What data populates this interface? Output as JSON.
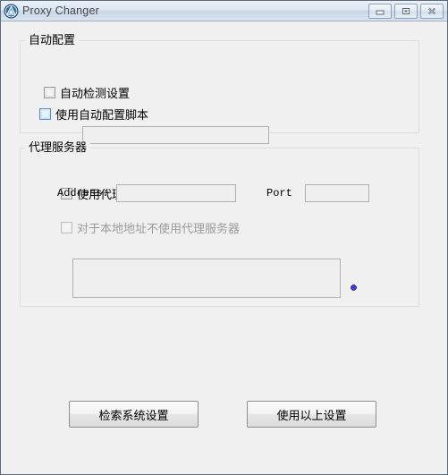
{
  "window": {
    "title": "Proxy Changer",
    "icon": "app-logo-icon",
    "controls": {
      "minimize_label": "Minimize",
      "maximize_label": "Maximize",
      "close_label": "Close"
    }
  },
  "auto_config": {
    "legend": "自动配置",
    "detect_checkbox": {
      "label": "自动检测设置",
      "checked": false
    },
    "script_checkbox": {
      "label": "使用自动配置脚本",
      "checked": false
    },
    "script_url": {
      "value": "",
      "placeholder": ""
    }
  },
  "proxy_server": {
    "legend": "代理服务器",
    "use_proxy_checkbox": {
      "label": "使用代理服务器",
      "checked": false
    },
    "address_label": "Address:",
    "address_value": "",
    "port_label": "Port",
    "port_value": "",
    "bypass_checkbox": {
      "label": "对于本地地址不使用代理服务器",
      "checked": false
    },
    "exceptions_value": "",
    "marker": "blue-dot"
  },
  "actions": {
    "retrieve_label": "检索系统设置",
    "apply_label": "使用以上设置"
  },
  "colors": {
    "window_bg": "#f0f0f0",
    "titlebar_top": "#eaf1f8",
    "titlebar_bottom": "#d8e3ef",
    "group_border": "#d6dde4",
    "accent_blue": "#1414d2",
    "checkbox_highlight": "#5a8ec0"
  }
}
